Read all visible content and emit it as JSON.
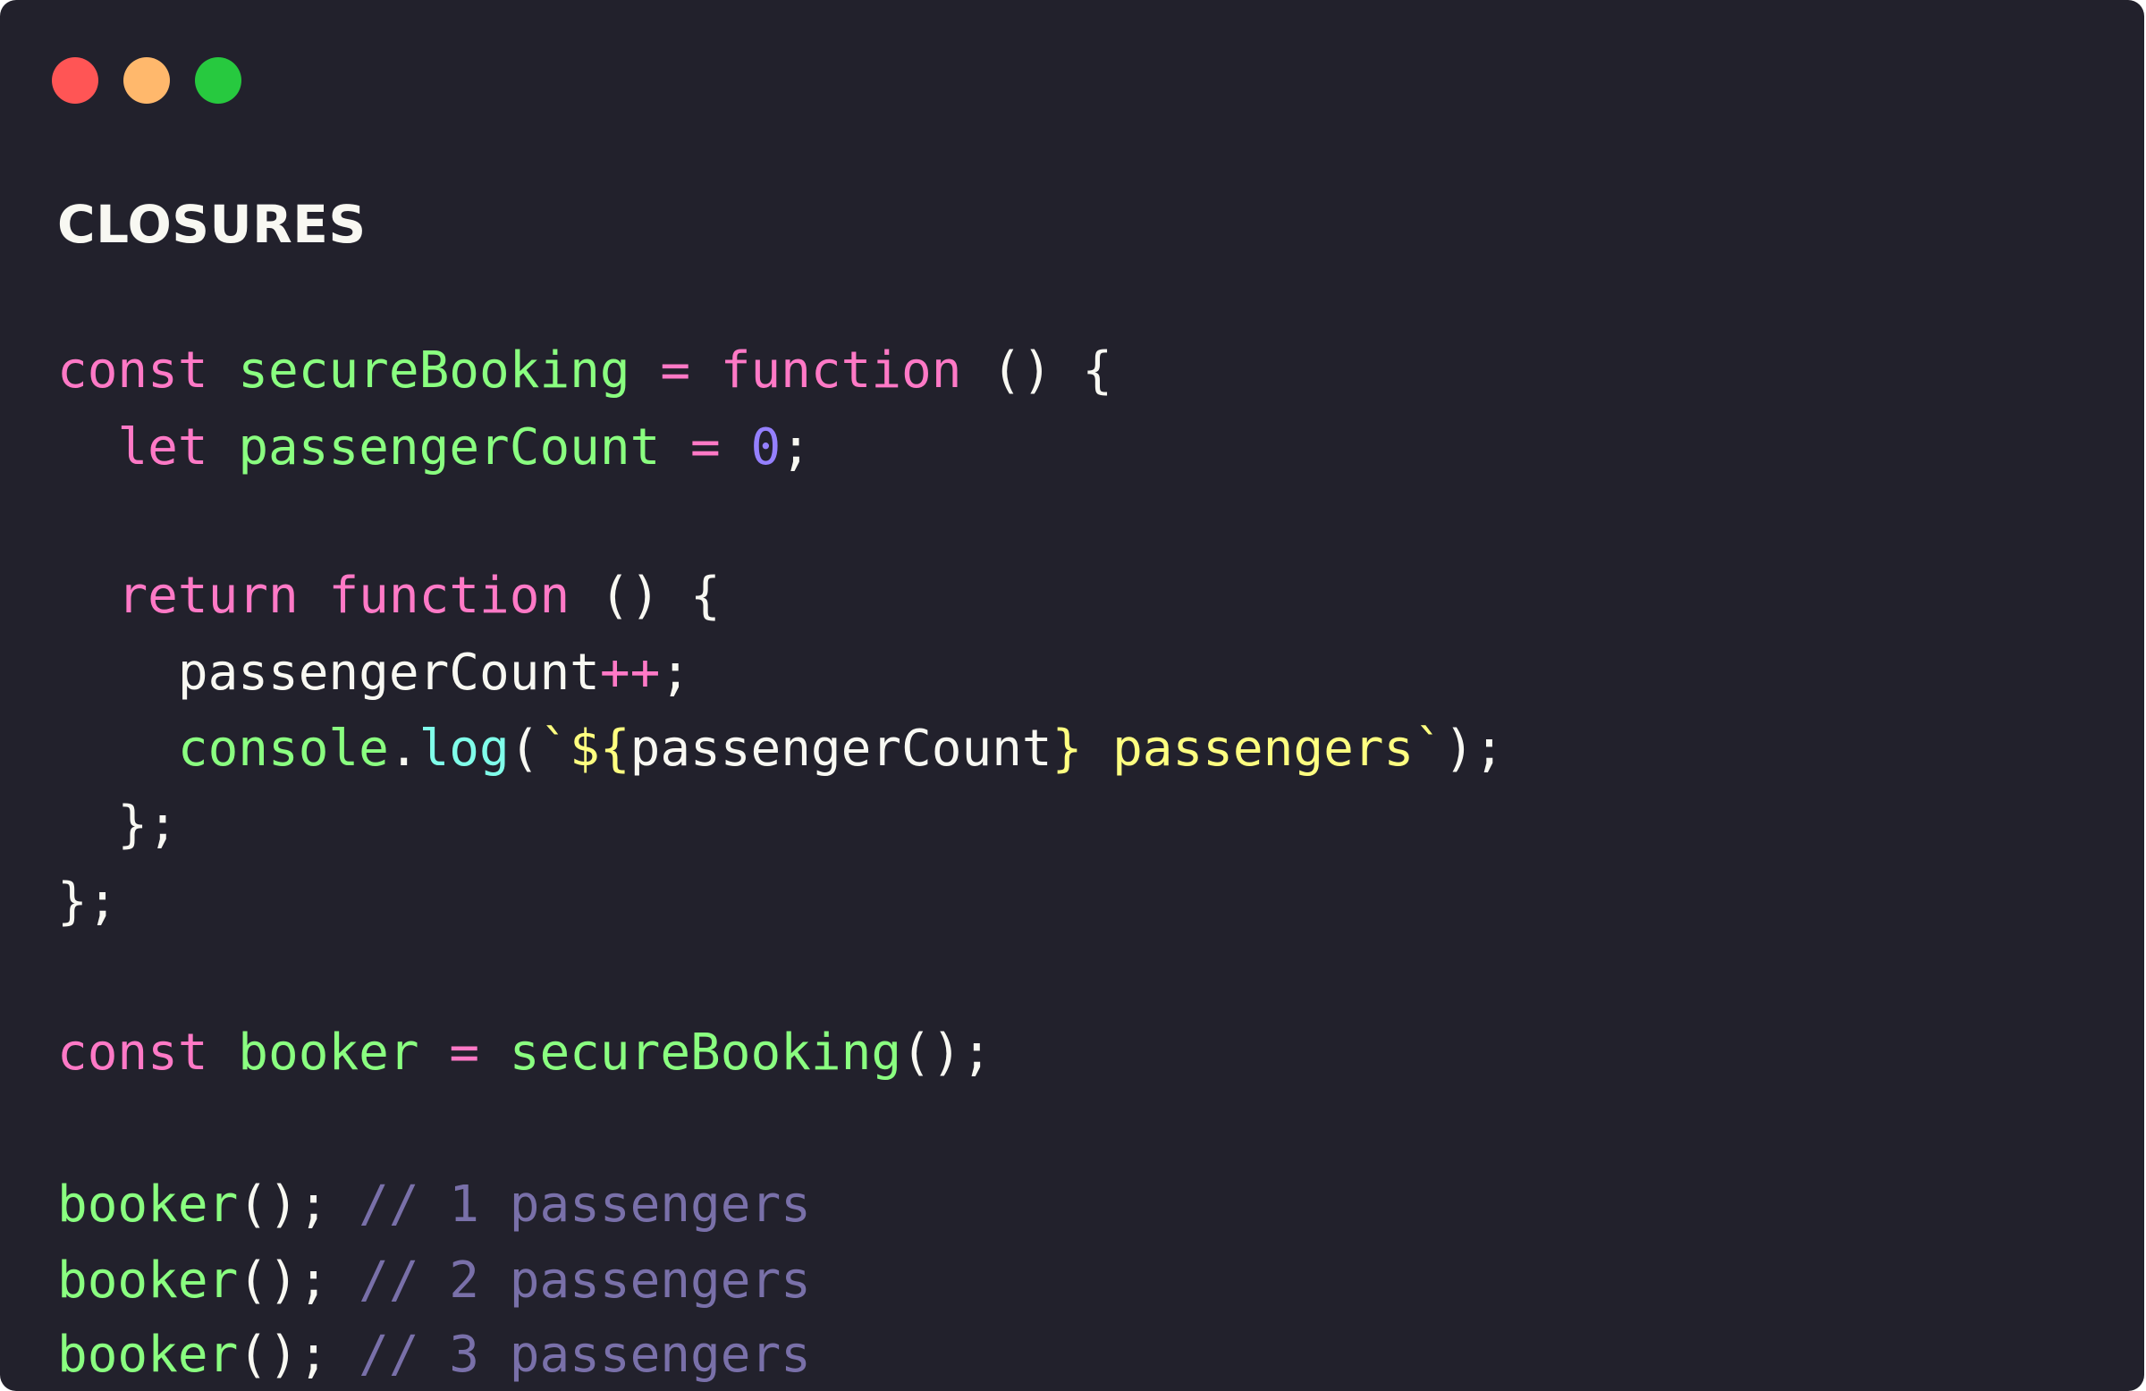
{
  "window": {
    "controls": [
      {
        "name": "close",
        "color": "#ff5555"
      },
      {
        "name": "minimize",
        "color": "#ffb86c"
      },
      {
        "name": "maximize",
        "color": "#27c93f"
      }
    ],
    "background": "#22212c"
  },
  "title": "CLOSURES",
  "code": {
    "language": "javascript",
    "lines": [
      {
        "tokens": [
          {
            "t": "const",
            "k": "kw"
          },
          {
            "t": " "
          },
          {
            "t": "secureBooking",
            "k": "fn"
          },
          {
            "t": " "
          },
          {
            "t": "=",
            "k": "kw"
          },
          {
            "t": " "
          },
          {
            "t": "function",
            "k": "kw"
          },
          {
            "t": " () {"
          }
        ]
      },
      {
        "tokens": [
          {
            "t": "  "
          },
          {
            "t": "let",
            "k": "kw"
          },
          {
            "t": " "
          },
          {
            "t": "passengerCount",
            "k": "fn"
          },
          {
            "t": " "
          },
          {
            "t": "=",
            "k": "kw"
          },
          {
            "t": " "
          },
          {
            "t": "0",
            "k": "num"
          },
          {
            "t": ";"
          }
        ]
      },
      {
        "tokens": [
          {
            "t": "  "
          },
          {
            "t": "return",
            "k": "kw"
          },
          {
            "t": " "
          },
          {
            "t": "function",
            "k": "kw"
          },
          {
            "t": " () {"
          }
        ]
      },
      {
        "tokens": [
          {
            "t": "    passengerCount"
          },
          {
            "t": "++",
            "k": "kw"
          },
          {
            "t": ";"
          }
        ]
      },
      {
        "tokens": [
          {
            "t": "    "
          },
          {
            "t": "console",
            "k": "fn"
          },
          {
            "t": "."
          },
          {
            "t": "log",
            "k": "method"
          },
          {
            "t": "("
          },
          {
            "t": "`${",
            "k": "str"
          },
          {
            "t": "passengerCount"
          },
          {
            "t": "} passengers`",
            "k": "str"
          },
          {
            "t": ");"
          }
        ]
      },
      {
        "tokens": [
          {
            "t": "  };"
          }
        ]
      },
      {
        "tokens": [
          {
            "t": "};"
          }
        ]
      },
      {
        "tokens": [
          {
            "t": "const",
            "k": "kw"
          },
          {
            "t": " "
          },
          {
            "t": "booker",
            "k": "fn"
          },
          {
            "t": " "
          },
          {
            "t": "=",
            "k": "kw"
          },
          {
            "t": " "
          },
          {
            "t": "secureBooking",
            "k": "fn"
          },
          {
            "t": "();"
          }
        ]
      },
      {
        "tokens": [
          {
            "t": "booker",
            "k": "fn"
          },
          {
            "t": "(); "
          },
          {
            "t": "// 1 passengers",
            "k": "comment"
          }
        ]
      },
      {
        "tokens": [
          {
            "t": "booker",
            "k": "fn"
          },
          {
            "t": "(); "
          },
          {
            "t": "// 2 passengers",
            "k": "comment"
          }
        ]
      },
      {
        "tokens": [
          {
            "t": "booker",
            "k": "fn"
          },
          {
            "t": "(); "
          },
          {
            "t": "// 3 passengers",
            "k": "comment"
          }
        ]
      }
    ]
  }
}
